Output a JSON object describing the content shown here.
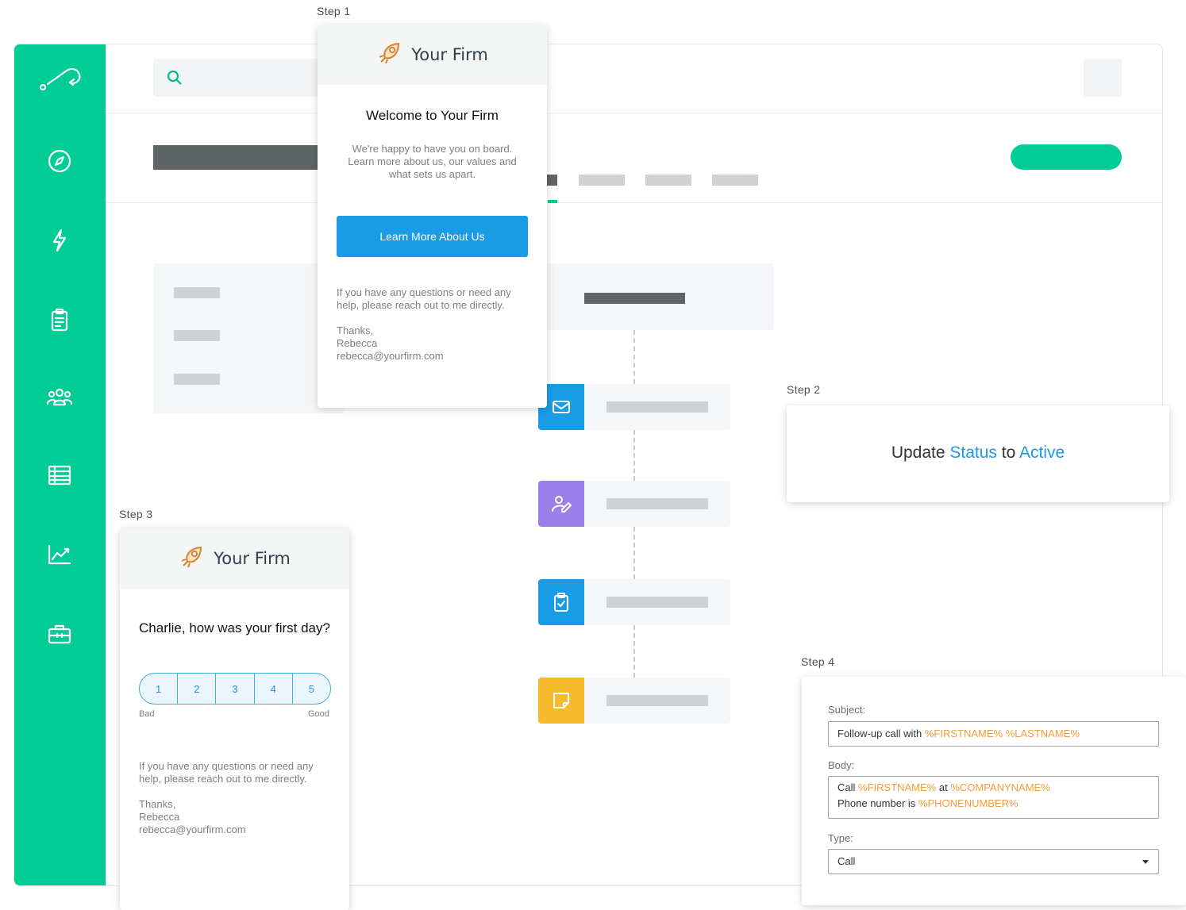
{
  "colors": {
    "accent_green": "#00cc96",
    "blue": "#1a9be6",
    "purple": "#9b7fe8",
    "orange": "#f6bb2c",
    "variable_orange": "#f39c38"
  },
  "sidebar": {
    "icons": [
      "logo-icon",
      "compass-icon",
      "lightning-icon",
      "clipboard-icon",
      "users-icon",
      "table-icon",
      "chart-icon",
      "toolbox-icon"
    ]
  },
  "flow": {
    "items": [
      {
        "icon": "mail-icon",
        "color": "#1a9be6"
      },
      {
        "icon": "user-edit-icon",
        "color": "#9b7fe8"
      },
      {
        "icon": "clipboard-check-icon",
        "color": "#1a9be6"
      },
      {
        "icon": "note-icon",
        "color": "#f6bb2c"
      }
    ]
  },
  "step1": {
    "label": "Step 1",
    "brand": "Your Firm",
    "title": "Welcome to Your Firm",
    "intro": "We're happy to have you on board. Learn more about us, our values and what sets us apart.",
    "button": "Learn More About Us",
    "questions": "If you have any questions or need any help, please reach out to me directly.",
    "thanks": "Thanks,",
    "name": "Rebecca",
    "email": "rebecca@yourfirm.com"
  },
  "step2": {
    "label": "Step 2",
    "pre": "Update ",
    "field": "Status",
    "mid": " to ",
    "value": "Active"
  },
  "step3": {
    "label": "Step 3",
    "brand": "Your Firm",
    "question": "Charlie, how was your first day?",
    "ratings": [
      "1",
      "2",
      "3",
      "4",
      "5"
    ],
    "rating_value": null,
    "low_label": "Bad",
    "high_label": "Good",
    "questions": "If you have any questions or need any help, please reach out to me directly.",
    "thanks": "Thanks,",
    "name": "Rebecca",
    "email": "rebecca@yourfirm.com"
  },
  "step4": {
    "label": "Step 4",
    "subject_label": "Subject:",
    "subject_text": "Follow-up call with ",
    "subject_var1": "%FIRSTNAME%",
    "subject_sep": " ",
    "subject_var2": "%LASTNAME%",
    "body_label": "Body:",
    "body_line1_a": "Call ",
    "body_line1_var1": "%FIRSTNAME%",
    "body_line1_b": " at ",
    "body_line1_var2": "%COMPANYNAME%",
    "body_line2_a": "Phone number is ",
    "body_line2_var": "%PHONENUMBER%",
    "type_label": "Type:",
    "type_value": "Call"
  }
}
